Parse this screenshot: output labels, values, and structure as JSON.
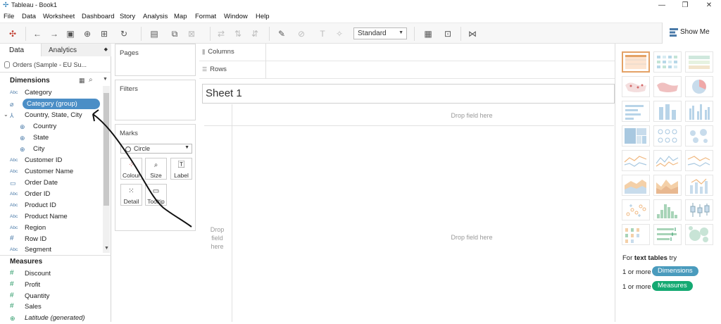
{
  "window": {
    "title": "Tableau - Book1"
  },
  "menu": [
    "File",
    "Data",
    "Worksheet",
    "Dashboard",
    "Story",
    "Analysis",
    "Map",
    "Format",
    "Window",
    "Help"
  ],
  "toolbar": {
    "view_mode": "Standard",
    "show_me_label": "Show Me"
  },
  "data_pane": {
    "tab_data": "Data",
    "tab_analytics": "Analytics",
    "datasource": "Orders (Sample - EU Su...",
    "dimensions_header": "Dimensions",
    "measures_header": "Measures",
    "dimensions": [
      {
        "icon": "Abc",
        "label": "Category"
      },
      {
        "icon": "paperclip",
        "label": "Category (group)",
        "selected": true
      },
      {
        "icon": "hierarchy",
        "label": "Country, State, City"
      },
      {
        "icon": "globe",
        "label": "Country",
        "indent": true
      },
      {
        "icon": "globe",
        "label": "State",
        "indent": true
      },
      {
        "icon": "globe",
        "label": "City",
        "indent": true
      },
      {
        "icon": "Abc",
        "label": "Customer ID"
      },
      {
        "icon": "Abc",
        "label": "Customer Name"
      },
      {
        "icon": "calendar",
        "label": "Order Date"
      },
      {
        "icon": "Abc",
        "label": "Order ID"
      },
      {
        "icon": "Abc",
        "label": "Product ID"
      },
      {
        "icon": "Abc",
        "label": "Product Name"
      },
      {
        "icon": "Abc",
        "label": "Region"
      },
      {
        "icon": "#",
        "label": "Row ID"
      },
      {
        "icon": "Abc",
        "label": "Segment"
      }
    ],
    "measures": [
      {
        "icon": "#",
        "label": "Discount"
      },
      {
        "icon": "#",
        "label": "Profit"
      },
      {
        "icon": "#",
        "label": "Quantity"
      },
      {
        "icon": "#",
        "label": "Sales"
      },
      {
        "icon": "globe",
        "label": "Latitude (generated)"
      }
    ]
  },
  "cards": {
    "pages": "Pages",
    "filters": "Filters",
    "marks": "Marks",
    "mark_type": "Circle",
    "mark_buttons": [
      "Colour",
      "Size",
      "Label",
      "Detail",
      "Tooltip"
    ]
  },
  "shelves": {
    "columns": "Columns",
    "rows": "Rows"
  },
  "sheet": {
    "title": "Sheet 1",
    "drop_top": "Drop field here",
    "drop_center": "Drop field here",
    "drop_left": "Drop\nfield\nhere"
  },
  "show_me": {
    "hint_prefix": "For ",
    "hint_bold": "text tables",
    "hint_suffix": " try",
    "req1_prefix": "1 or more",
    "req1_pill": "Dimensions",
    "req2_prefix": "1 or more",
    "req2_pill": "Measures",
    "dimension_color": "#4a9bbd",
    "measure_color": "#14a972"
  }
}
